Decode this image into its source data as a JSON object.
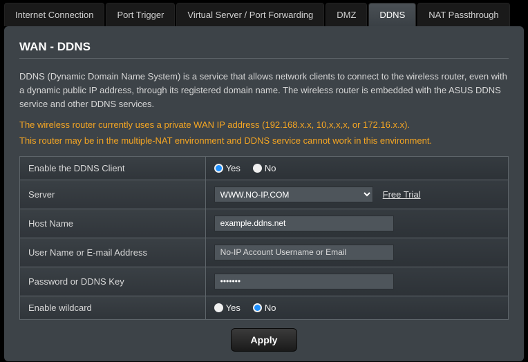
{
  "tabs": {
    "internet": "Internet Connection",
    "porttrigger": "Port Trigger",
    "vserver": "Virtual Server / Port Forwarding",
    "dmz": "DMZ",
    "ddns": "DDNS",
    "natpass": "NAT Passthrough"
  },
  "panel": {
    "title": "WAN - DDNS",
    "description": "DDNS (Dynamic Domain Name System) is a service that allows network clients to connect to the wireless router, even with a dynamic public IP address, through its registered domain name. The wireless router is embedded with the ASUS DDNS service and other DDNS services.",
    "warn1": "The wireless router currently uses a private WAN IP address (192.168.x.x, 10,x,x,x, or 172.16.x.x).",
    "warn2": "This router may be in the multiple-NAT environment and DDNS service cannot work in this environment."
  },
  "fields": {
    "enable_client_label": "Enable the DDNS Client",
    "yes": "Yes",
    "no": "No",
    "server_label": "Server",
    "server_value": "WWW.NO-IP.COM",
    "free_trial": "Free Trial",
    "hostname_label": "Host Name",
    "hostname_value": "example.ddns.net",
    "username_label": "User Name or E-mail Address",
    "username_placeholder": "No-IP Account Username or Email",
    "username_value": "",
    "password_label": "Password or DDNS Key",
    "password_value": "•••••••",
    "wildcard_label": "Enable wildcard"
  },
  "buttons": {
    "apply": "Apply"
  },
  "state": {
    "enable_client": "yes",
    "enable_wildcard": "no"
  }
}
